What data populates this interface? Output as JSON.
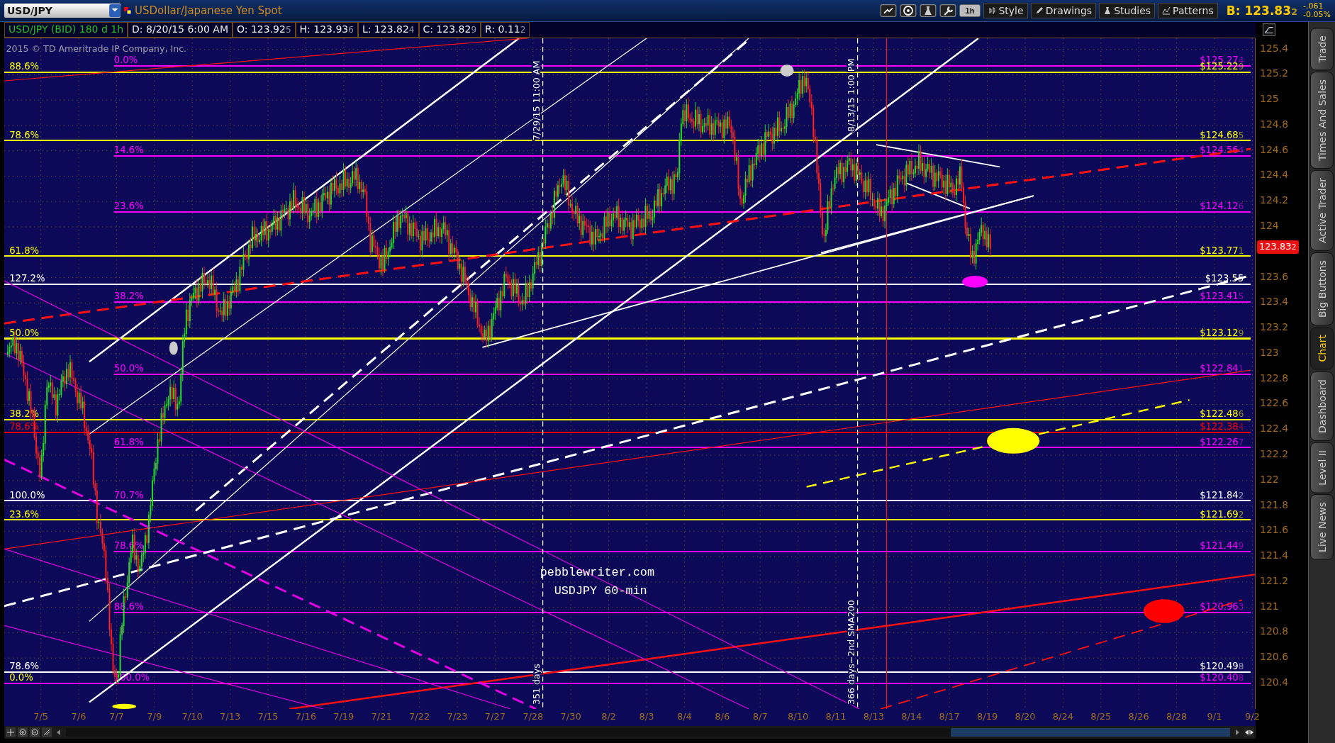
{
  "toolbar": {
    "symbol": "USD/JPY",
    "description": "USDollar/Japanese Yen Spot",
    "interval": "1h",
    "buttons": [
      {
        "label": "Style",
        "kind": "style"
      },
      {
        "label": "Drawings",
        "kind": "drawings"
      },
      {
        "label": "Studies",
        "kind": "studies"
      },
      {
        "label": "Patterns",
        "kind": "patterns"
      }
    ],
    "bid": {
      "text": "B: 123.83",
      "sub": "2"
    },
    "change": "-.061",
    "change_percent": "-0.05%"
  },
  "info_bar": {
    "title": "USD/JPY (BID) 180 d 1h",
    "fields": [
      {
        "text": "D: 8/20/15 6:00 AM"
      },
      {
        "text": "O: 123.92",
        "sub": "5"
      },
      {
        "text": "H: 123.93",
        "sub": "6"
      },
      {
        "text": "L: 123.82",
        "sub": "4"
      },
      {
        "text": "C: 123.82",
        "sub": "9"
      },
      {
        "text": "R: 0.11",
        "sub": "2"
      }
    ]
  },
  "chart": {
    "copyright": "2015 © TD Ameritrade IP Company, Inc.",
    "watermark": [
      "pebblewriter.com",
      "USDJPY 60-min"
    ],
    "vertical_notes": [
      "7/29/15 11:00 AM",
      "351 days",
      "8/13/15 1:00 PM",
      "366 days~2nd SMA200"
    ],
    "levels": [
      {
        "color": "#ff00ff",
        "kind": "inner",
        "price": "$125.27",
        "sub": "4",
        "labels": [
          {
            "text": "0.0%",
            "color": "#ff00ff",
            "kind": "inner"
          }
        ]
      },
      {
        "color": "#ffff00",
        "kind": "full",
        "price": "$125.22",
        "sub": "9",
        "labels": [
          {
            "text": "88.6%",
            "color": "#ffff00",
            "kind": "outer"
          }
        ]
      },
      {
        "color": "#ffff00",
        "kind": "full",
        "price": "$124.68",
        "sub": "5",
        "labels": [
          {
            "text": "78.6%",
            "color": "#ffff00",
            "kind": "outer"
          }
        ]
      },
      {
        "color": "#ff00ff",
        "kind": "inner",
        "price": "$124.56",
        "sub": "4",
        "labels": [
          {
            "text": "14.6%",
            "color": "#ff00ff",
            "kind": "inner"
          }
        ]
      },
      {
        "color": "#ff00ff",
        "kind": "inner",
        "price": "$124.12",
        "sub": "6",
        "labels": [
          {
            "text": "23.6%",
            "color": "#ff00ff",
            "kind": "inner"
          }
        ]
      },
      {
        "color": "#ffff00",
        "kind": "full",
        "price": "$123.77",
        "sub": "1",
        "labels": [
          {
            "text": "61.8%",
            "color": "#ffff00",
            "kind": "outer"
          }
        ]
      },
      {
        "color": "#ffffff",
        "kind": "full",
        "price": "$123.55",
        "labels": [
          {
            "text": "127.2%",
            "color": "#ffffff",
            "kind": "outer"
          }
        ]
      },
      {
        "color": "#ff00ff",
        "kind": "inner",
        "price": "$123.41",
        "sub": "5",
        "labels": [
          {
            "text": "38.2%",
            "color": "#ff00ff",
            "kind": "inner"
          }
        ]
      },
      {
        "color": "#ffff00",
        "kind": "full",
        "price": "$123.12",
        "sub": "9",
        "labels": [
          {
            "text": "50.0%",
            "color": "#ffff00",
            "kind": "outer"
          }
        ]
      },
      {
        "color": "#ff00ff",
        "kind": "inner",
        "price": "$122.84",
        "sub": "1",
        "labels": [
          {
            "text": "50.0%",
            "color": "#ff00ff",
            "kind": "inner"
          }
        ]
      },
      {
        "color": "#ffff00",
        "kind": "full",
        "price": "$122.48",
        "sub": "6",
        "labels": [
          {
            "text": "38.2%",
            "color": "#ffff00",
            "kind": "outer"
          }
        ]
      },
      {
        "color": "#ff0000",
        "kind": "full",
        "price": "$122.38",
        "sub": "4",
        "labels": [
          {
            "text": "78.6%",
            "color": "#ff0000",
            "kind": "outer"
          }
        ]
      },
      {
        "color": "#ff00ff",
        "kind": "inner",
        "price": "$122.26",
        "sub": "7",
        "labels": [
          {
            "text": "61.8%",
            "color": "#ff00ff",
            "kind": "inner"
          }
        ]
      },
      {
        "color": "#ffffff",
        "kind": "full",
        "price": "$121.84",
        "sub": "2",
        "labels": [
          {
            "text": "100.0%",
            "color": "#ffffff",
            "kind": "outer"
          },
          {
            "text": "70.7%",
            "color": "#ff00ff",
            "kind": "inner"
          }
        ]
      },
      {
        "color": "#ffff00",
        "kind": "full",
        "price": "$121.69",
        "sub": "2",
        "labels": [
          {
            "text": "23.6%",
            "color": "#ffff00",
            "kind": "outer"
          }
        ]
      },
      {
        "color": "#ff00ff",
        "kind": "inner",
        "price": "$121.44",
        "sub": "9",
        "labels": [
          {
            "text": "78.6%",
            "color": "#ff00ff",
            "kind": "inner"
          }
        ]
      },
      {
        "color": "#ff00ff",
        "kind": "inner",
        "price": "$120.96",
        "sub": "3",
        "labels": [
          {
            "text": "88.6%",
            "color": "#ff00ff",
            "kind": "inner"
          }
        ]
      },
      {
        "color": "#ffffff",
        "kind": "full",
        "price": "$120.49",
        "sub": "8",
        "labels": [
          {
            "text": "78.6%",
            "color": "#ffffff",
            "kind": "outer"
          }
        ]
      },
      {
        "color": "#ff00ff",
        "kind": "full",
        "price": "$120.40",
        "sub": "8",
        "labels": [
          {
            "text": "0.0%",
            "color": "#ffff00",
            "kind": "outer"
          },
          {
            "text": "100.0%",
            "color": "#ff00ff",
            "kind": "inner"
          }
        ]
      }
    ],
    "price_tag": {
      "text": "123.83",
      "sub": "2"
    },
    "y_ticks": [
      "125.4",
      "125.2",
      "125",
      "124.8",
      "124.6",
      "124.4",
      "124.2",
      "124",
      "123.6",
      "123.4",
      "123.2",
      "123",
      "122.8",
      "122.6",
      "122.4",
      "122.2",
      "122",
      "121.8",
      "121.6",
      "121.4",
      "121.2",
      "121",
      "120.8",
      "120.6",
      "120.4"
    ],
    "x_ticks": [
      "7/5",
      "7/6",
      "7/7",
      "7/9",
      "7/10",
      "7/13",
      "7/15",
      "7/16",
      "7/19",
      "7/21",
      "7/22",
      "7/23",
      "7/27",
      "7/28",
      "7/30",
      "8/2",
      "8/3",
      "8/4",
      "8/6",
      "8/7",
      "8/10",
      "8/11",
      "8/13",
      "8/14",
      "8/17",
      "8/19",
      "8/20",
      "8/24",
      "8/25",
      "8/26",
      "8/28",
      "9/1",
      "9/2"
    ]
  },
  "side_tabs": [
    {
      "label": "Trade",
      "selected": false
    },
    {
      "label": "Times And Sales",
      "selected": false
    },
    {
      "label": "Active Trader",
      "selected": false
    },
    {
      "label": "Big Buttons",
      "selected": false
    },
    {
      "label": "Chart",
      "selected": true
    },
    {
      "label": "Dashboard",
      "selected": false
    },
    {
      "label": "Level II",
      "selected": false
    },
    {
      "label": "Live News",
      "selected": false
    }
  ]
}
